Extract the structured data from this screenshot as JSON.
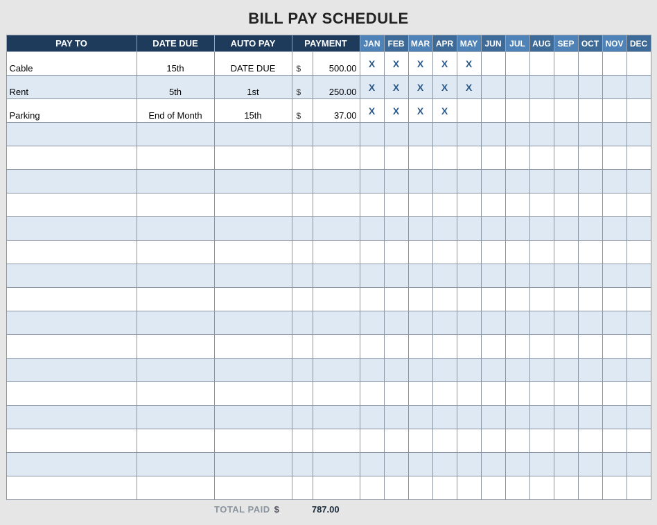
{
  "title": "BILL PAY SCHEDULE",
  "months": [
    "JAN",
    "FEB",
    "MAR",
    "APR",
    "MAY",
    "JUN",
    "JUL",
    "AUG",
    "SEP",
    "OCT",
    "NOV",
    "DEC"
  ],
  "columns": {
    "pay_to": "PAY TO",
    "date_due": "DATE DUE",
    "auto_pay": "AUTO PAY",
    "payment": "PAYMENT"
  },
  "currency": "$",
  "rows": [
    {
      "pay_to": "Cable",
      "date_due": "15th",
      "auto_pay": "DATE DUE",
      "payment": "500.00",
      "marks": [
        "X",
        "X",
        "X",
        "X",
        "X",
        "",
        "",
        "",
        "",
        "",
        "",
        ""
      ]
    },
    {
      "pay_to": "Rent",
      "date_due": "5th",
      "auto_pay": "1st",
      "payment": "250.00",
      "marks": [
        "X",
        "X",
        "X",
        "X",
        "X",
        "",
        "",
        "",
        "",
        "",
        "",
        ""
      ]
    },
    {
      "pay_to": "Parking",
      "date_due": "End of Month",
      "auto_pay": "15th",
      "payment": "37.00",
      "marks": [
        "X",
        "X",
        "X",
        "X",
        "",
        "",
        "",
        "",
        "",
        "",
        "",
        ""
      ]
    },
    {
      "pay_to": "",
      "date_due": "",
      "auto_pay": "",
      "payment": "",
      "marks": [
        "",
        "",
        "",
        "",
        "",
        "",
        "",
        "",
        "",
        "",
        "",
        ""
      ]
    },
    {
      "pay_to": "",
      "date_due": "",
      "auto_pay": "",
      "payment": "",
      "marks": [
        "",
        "",
        "",
        "",
        "",
        "",
        "",
        "",
        "",
        "",
        "",
        ""
      ]
    },
    {
      "pay_to": "",
      "date_due": "",
      "auto_pay": "",
      "payment": "",
      "marks": [
        "",
        "",
        "",
        "",
        "",
        "",
        "",
        "",
        "",
        "",
        "",
        ""
      ]
    },
    {
      "pay_to": "",
      "date_due": "",
      "auto_pay": "",
      "payment": "",
      "marks": [
        "",
        "",
        "",
        "",
        "",
        "",
        "",
        "",
        "",
        "",
        "",
        ""
      ]
    },
    {
      "pay_to": "",
      "date_due": "",
      "auto_pay": "",
      "payment": "",
      "marks": [
        "",
        "",
        "",
        "",
        "",
        "",
        "",
        "",
        "",
        "",
        "",
        ""
      ]
    },
    {
      "pay_to": "",
      "date_due": "",
      "auto_pay": "",
      "payment": "",
      "marks": [
        "",
        "",
        "",
        "",
        "",
        "",
        "",
        "",
        "",
        "",
        "",
        ""
      ]
    },
    {
      "pay_to": "",
      "date_due": "",
      "auto_pay": "",
      "payment": "",
      "marks": [
        "",
        "",
        "",
        "",
        "",
        "",
        "",
        "",
        "",
        "",
        "",
        ""
      ]
    },
    {
      "pay_to": "",
      "date_due": "",
      "auto_pay": "",
      "payment": "",
      "marks": [
        "",
        "",
        "",
        "",
        "",
        "",
        "",
        "",
        "",
        "",
        "",
        ""
      ]
    },
    {
      "pay_to": "",
      "date_due": "",
      "auto_pay": "",
      "payment": "",
      "marks": [
        "",
        "",
        "",
        "",
        "",
        "",
        "",
        "",
        "",
        "",
        "",
        ""
      ]
    },
    {
      "pay_to": "",
      "date_due": "",
      "auto_pay": "",
      "payment": "",
      "marks": [
        "",
        "",
        "",
        "",
        "",
        "",
        "",
        "",
        "",
        "",
        "",
        ""
      ]
    },
    {
      "pay_to": "",
      "date_due": "",
      "auto_pay": "",
      "payment": "",
      "marks": [
        "",
        "",
        "",
        "",
        "",
        "",
        "",
        "",
        "",
        "",
        "",
        ""
      ]
    },
    {
      "pay_to": "",
      "date_due": "",
      "auto_pay": "",
      "payment": "",
      "marks": [
        "",
        "",
        "",
        "",
        "",
        "",
        "",
        "",
        "",
        "",
        "",
        ""
      ]
    },
    {
      "pay_to": "",
      "date_due": "",
      "auto_pay": "",
      "payment": "",
      "marks": [
        "",
        "",
        "",
        "",
        "",
        "",
        "",
        "",
        "",
        "",
        "",
        ""
      ]
    },
    {
      "pay_to": "",
      "date_due": "",
      "auto_pay": "",
      "payment": "",
      "marks": [
        "",
        "",
        "",
        "",
        "",
        "",
        "",
        "",
        "",
        "",
        "",
        ""
      ]
    },
    {
      "pay_to": "",
      "date_due": "",
      "auto_pay": "",
      "payment": "",
      "marks": [
        "",
        "",
        "",
        "",
        "",
        "",
        "",
        "",
        "",
        "",
        "",
        ""
      ]
    },
    {
      "pay_to": "",
      "date_due": "",
      "auto_pay": "",
      "payment": "",
      "marks": [
        "",
        "",
        "",
        "",
        "",
        "",
        "",
        "",
        "",
        "",
        "",
        ""
      ]
    }
  ],
  "footer": {
    "label": "TOTAL PAID",
    "currency": "$",
    "value": "787.00"
  },
  "chart_data": {
    "type": "table",
    "title": "BILL PAY SCHEDULE",
    "columns": [
      "PAY TO",
      "DATE DUE",
      "AUTO PAY",
      "PAYMENT",
      "JAN",
      "FEB",
      "MAR",
      "APR",
      "MAY",
      "JUN",
      "JUL",
      "AUG",
      "SEP",
      "OCT",
      "NOV",
      "DEC"
    ],
    "rows": [
      [
        "Cable",
        "15th",
        "DATE DUE",
        500.0,
        "X",
        "X",
        "X",
        "X",
        "X",
        "",
        "",
        "",
        "",
        "",
        "",
        ""
      ],
      [
        "Rent",
        "5th",
        "1st",
        250.0,
        "X",
        "X",
        "X",
        "X",
        "X",
        "",
        "",
        "",
        "",
        "",
        "",
        ""
      ],
      [
        "Parking",
        "End of Month",
        "15th",
        37.0,
        "X",
        "X",
        "X",
        "X",
        "",
        "",
        "",
        "",
        "",
        "",
        "",
        ""
      ]
    ],
    "total_paid": 787.0
  }
}
